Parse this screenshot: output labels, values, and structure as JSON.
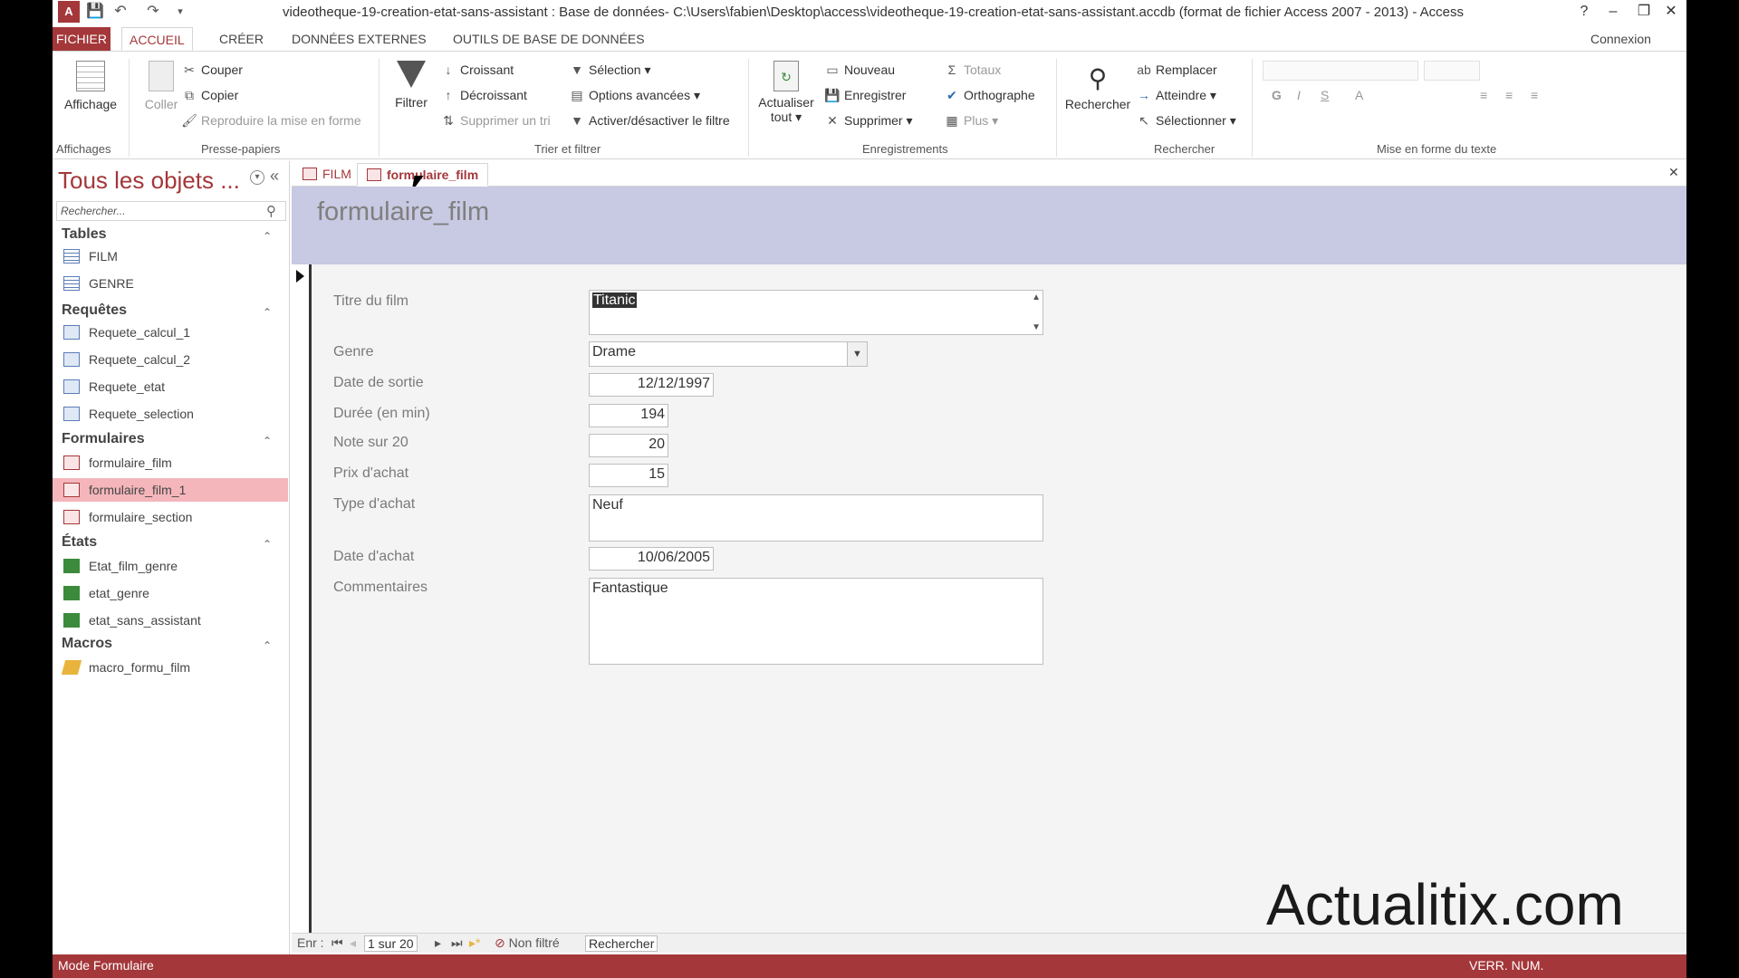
{
  "window": {
    "title": "videotheque-19-creation-etat-sans-assistant : Base de données- C:\\Users\\fabien\\Desktop\\access\\videotheque-19-creation-etat-sans-assistant.accdb (format de fichier Access 2007 - 2013) - Access",
    "logo": "A",
    "help": "?",
    "minimize": "–",
    "restore": "❐",
    "close": "✕",
    "signin": "Connexion"
  },
  "menu_tabs": [
    "FICHIER",
    "ACCUEIL",
    "CRÉER",
    "DONNÉES EXTERNES",
    "OUTILS DE BASE DE DONNÉES"
  ],
  "ribbon": {
    "affichages": {
      "label": "Affichage",
      "group": "Affichages"
    },
    "presse": {
      "coller": "Coller",
      "couper": "Couper",
      "copier": "Copier",
      "reproduire": "Reproduire la mise en forme",
      "group": "Presse-papiers"
    },
    "trier": {
      "filtrer": "Filtrer",
      "croissant": "Croissant",
      "decroissant": "Décroissant",
      "supprimer_tri": "Supprimer un tri",
      "selection": "Sélection",
      "options": "Options avancées",
      "activer": "Activer/désactiver le filtre",
      "group": "Trier et filtrer"
    },
    "enreg": {
      "actualiser": "Actualiser",
      "tout": "tout",
      "nouveau": "Nouveau",
      "enregistrer": "Enregistrer",
      "supprimer": "Supprimer",
      "totaux": "Totaux",
      "orthographe": "Orthographe",
      "plus": "Plus",
      "group": "Enregistrements"
    },
    "rechercher": {
      "rechercher": "Rechercher",
      "remplacer": "Remplacer",
      "atteindre": "Atteindre",
      "selectionner": "Sélectionner",
      "group": "Rechercher"
    },
    "format": {
      "group": "Mise en forme du texte",
      "bold": "G",
      "italic": "I",
      "underline": "S",
      "fontcolor": "A"
    }
  },
  "nav": {
    "header": "Tous les objets ...",
    "search_placeholder": "Rechercher...",
    "categories": [
      {
        "name": "Tables",
        "items": [
          "FILM",
          "GENRE"
        ]
      },
      {
        "name": "Requêtes",
        "items": [
          "Requete_calcul_1",
          "Requete_calcul_2",
          "Requete_etat",
          "Requete_selection"
        ]
      },
      {
        "name": "Formulaires",
        "items": [
          "formulaire_film",
          "formulaire_film_1",
          "formulaire_section"
        ]
      },
      {
        "name": "États",
        "items": [
          "Etat_film_genre",
          "etat_genre",
          "etat_sans_assistant"
        ]
      },
      {
        "name": "Macros",
        "items": [
          "macro_formu_film"
        ]
      }
    ]
  },
  "doc_tabs": [
    "FILM",
    "formulaire_film"
  ],
  "form": {
    "title": "formulaire_film",
    "fields": {
      "titre": {
        "label": "Titre du film",
        "value": "Titanic"
      },
      "genre": {
        "label": "Genre",
        "value": "Drame"
      },
      "date_sortie": {
        "label": "Date de sortie",
        "value": "12/12/1997"
      },
      "duree": {
        "label": "Durée (en min)",
        "value": "194"
      },
      "note": {
        "label": "Note sur 20",
        "value": "20"
      },
      "prix": {
        "label": "Prix d'achat",
        "value": "15"
      },
      "type": {
        "label": "Type d'achat",
        "value": "Neuf"
      },
      "date_achat": {
        "label": "Date d'achat",
        "value": "10/06/2005"
      },
      "commentaires": {
        "label": "Commentaires",
        "value": "Fantastique"
      }
    }
  },
  "record_nav": {
    "label": "Enr :",
    "position": "1 sur 20",
    "filter": "Non filtré",
    "search": "Rechercher"
  },
  "status": {
    "mode": "Mode Formulaire",
    "right": "VERR. NUM."
  },
  "watermark": "Actualitix.com"
}
